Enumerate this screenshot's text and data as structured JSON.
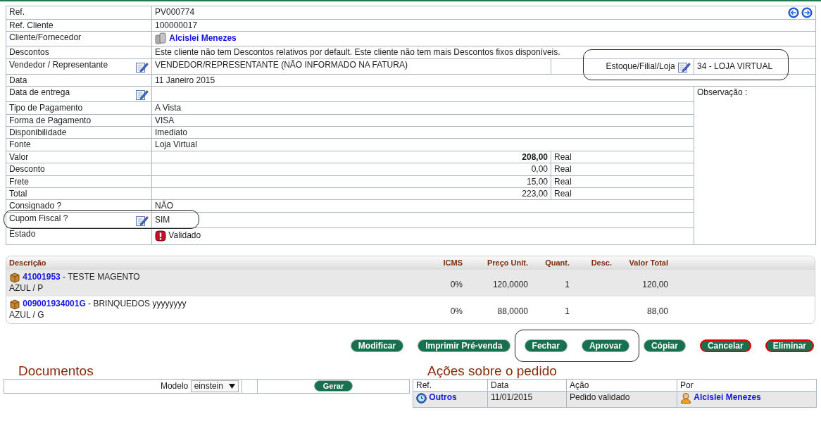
{
  "header_fields": [
    {
      "kind": "text",
      "label": "Ref.",
      "value": "PV000774"
    },
    {
      "kind": "text",
      "label": "Ref. Cliente",
      "value": "100000017"
    },
    {
      "kind": "link",
      "label": "Cliente/Fornecedor",
      "value": "Alcislei Menezes"
    },
    {
      "kind": "text",
      "label": "Descontos",
      "value": "Este cliente não tem Descontos relativos por default. Este cliente não tem mais Descontos fixos disponíveis."
    },
    {
      "kind": "edit",
      "label": "Vendedor / Representante",
      "value": "VENDEDOR/REPRESENTANTE (NÃO INFORMADO NA FATURA)",
      "extra": {
        "label": "Estoque/Filial/Loja",
        "value": "34 - LOJA VIRTUAL"
      }
    },
    {
      "kind": "text",
      "label": "Data",
      "value": "11 Janeiro 2015"
    }
  ],
  "observation": {
    "label": "Observação :"
  },
  "detail_fields": [
    {
      "kind": "edit",
      "label": "Data de entrega"
    },
    {
      "kind": "text",
      "label": "Tipo de Pagamento",
      "value": "A Vista"
    },
    {
      "kind": "text",
      "label": "Forma de Pagamento",
      "value": "VISA"
    },
    {
      "kind": "text",
      "label": "Disponibilidade",
      "value": "Imediato"
    },
    {
      "kind": "text",
      "label": "Fonte",
      "value": "Loja Virtual"
    },
    {
      "kind": "amount",
      "label": "Valor",
      "value": "208,00",
      "unit": "Real",
      "emphasized": true
    },
    {
      "kind": "amount",
      "label": "Desconto",
      "value": "0,00",
      "unit": "Real",
      "emphasized": false
    },
    {
      "kind": "amount",
      "label": "Frete",
      "value": "15,00",
      "unit": "Real",
      "emphasized": false
    },
    {
      "kind": "amount",
      "label": "Total",
      "value": "223,00",
      "unit": "Real",
      "emphasized": false
    },
    {
      "kind": "text",
      "label": "Consignado ?",
      "value": "NÃO"
    },
    {
      "kind": "edit",
      "label": "Cupom Fiscal ?",
      "value": "SIM"
    },
    {
      "kind": "status",
      "label": "Estado",
      "value": "Validado"
    }
  ],
  "lines": {
    "columns": [
      "Descrição",
      "ICMS",
      "Preço Unit.",
      "Quant.",
      "Desc.",
      "Valor Total"
    ],
    "rows": [
      {
        "ref": "41001953",
        "description": " - TESTE MAGENTO",
        "variant": "AZUL / P",
        "icms": "0%",
        "unit_price": "120,0000",
        "quantity": "1",
        "total": "120,00"
      },
      {
        "ref": "009001934001G",
        "description": " - BRINQUEDOS yyyyyyyy",
        "variant": "AZUL / G",
        "icms": "0%",
        "unit_price": "88,0000",
        "quantity": "1",
        "total": "88,00"
      }
    ]
  },
  "buttons": [
    {
      "label": "Modificar",
      "kind": "normal"
    },
    {
      "label": "Imprimir Pré-venda",
      "kind": "normal"
    },
    {
      "label": "Fechar",
      "kind": "normal"
    },
    {
      "label": "Aprovar",
      "kind": "normal"
    },
    {
      "label": "Cópiar",
      "kind": "normal"
    },
    {
      "label": "Cancelar",
      "kind": "danger"
    },
    {
      "label": "Eliminar",
      "kind": "danger"
    }
  ],
  "documents": {
    "title": "Documentos",
    "model_label": "Modelo",
    "model_value": "einstein",
    "generate_button": "Gerar"
  },
  "actions": {
    "title": "Ações sobre o pedido",
    "columns": [
      "Ref.",
      "Data",
      "Ação",
      "Por"
    ],
    "rows": [
      {
        "ref": "Outros",
        "date": "11/01/2015",
        "action": "Pedido validado",
        "by": "Alcislei Menezes"
      }
    ]
  }
}
